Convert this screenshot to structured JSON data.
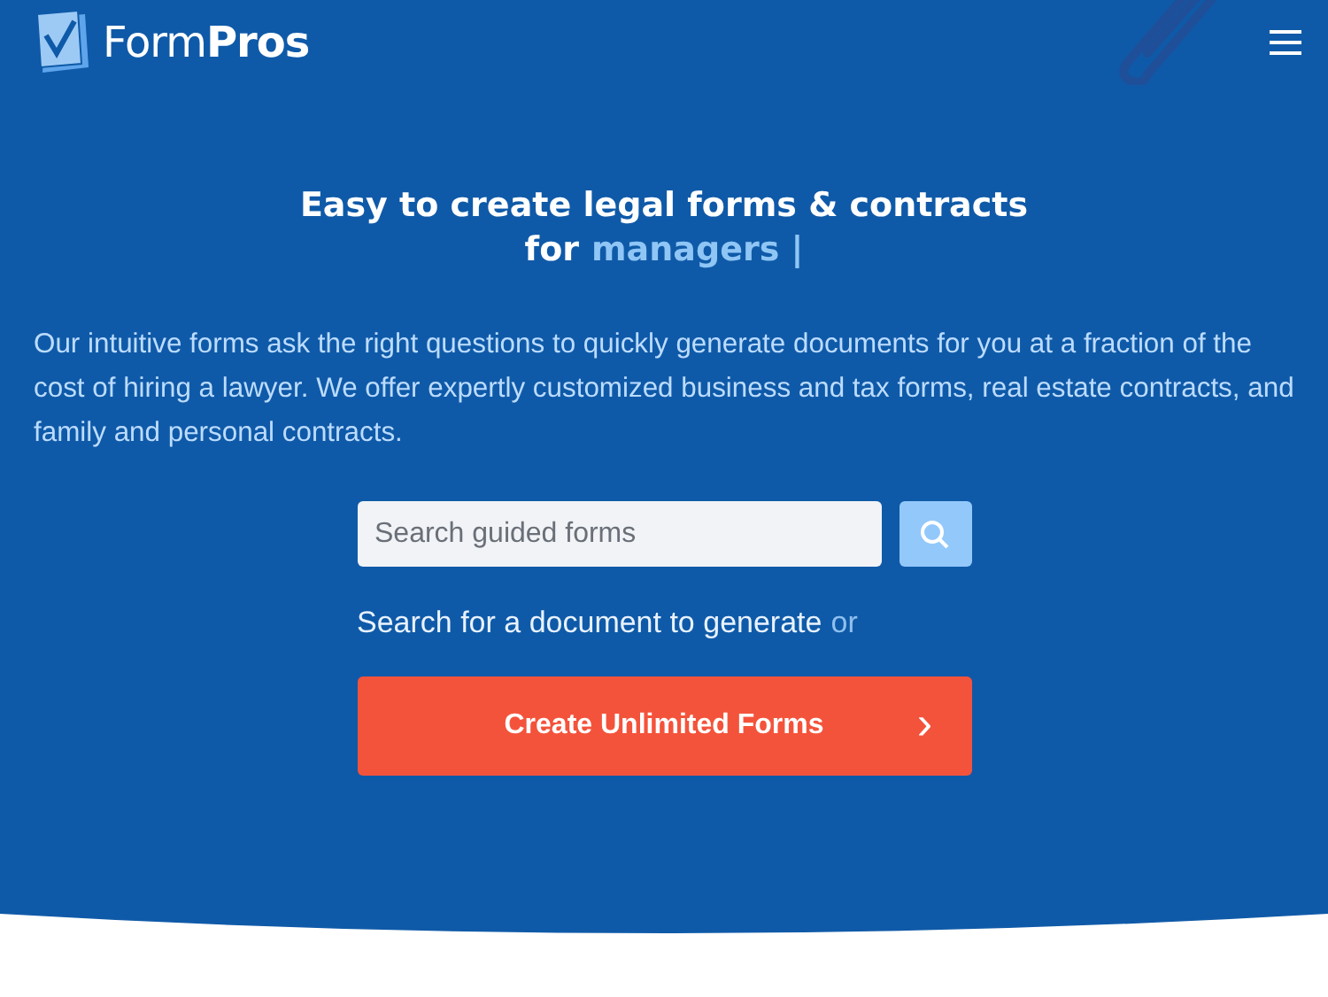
{
  "logo": {
    "text": "Form**Pros**"
  },
  "headline": {
    "line_1": "Easy to create legal forms & contracts",
    "line_2_prefix": "for",
    "highlight": "managers |"
  },
  "description": "Our intuitive forms ask the right questions to quickly generate documents for you at a fraction of the cost of hiring a lawyer. We offer expertly customized business and tax forms, real estate contracts, and family and personal contracts.",
  "search": {
    "placeholder": "Search guided forms"
  },
  "helper": {
    "text": "Search for a document to generate",
    "suffix": "or"
  },
  "cta": {
    "label": "Create Unlimited Forms",
    "chevron": "›"
  }
}
